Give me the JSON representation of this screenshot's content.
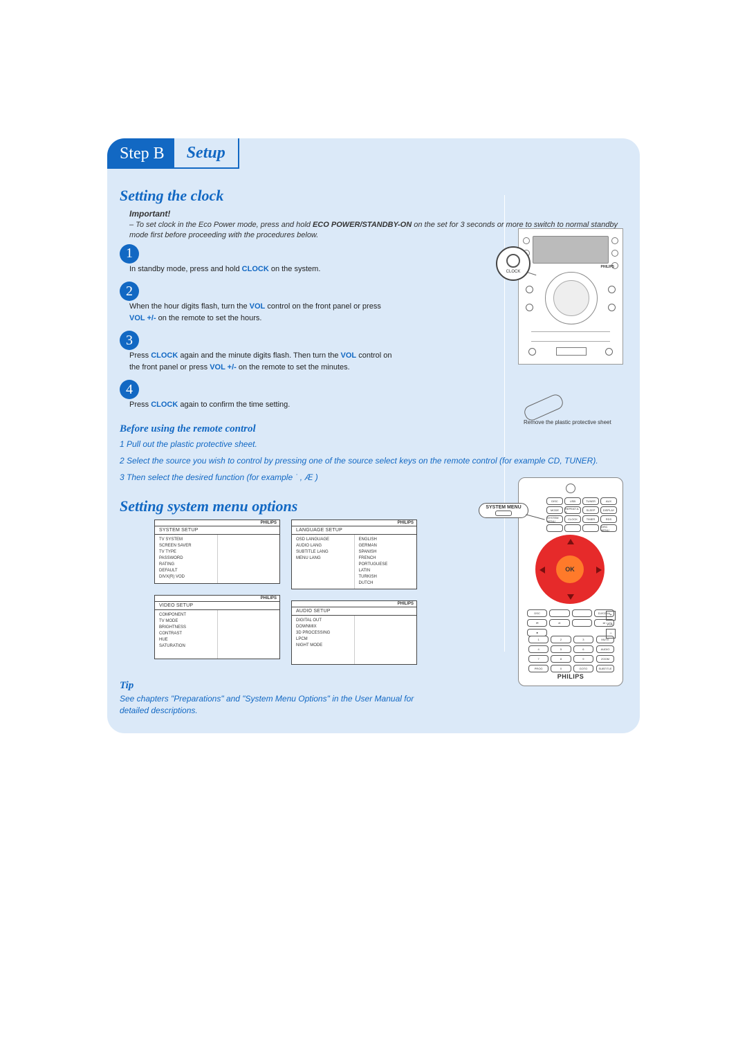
{
  "step_label": "Step B",
  "step_title": "Setup",
  "section1": {
    "heading": "Setting the clock",
    "important_label": "Important!",
    "important_text_pre": "– To set clock in the Eco Power mode, press and hold ",
    "important_bold": "ECO POWER/STANDBY-ON",
    "important_text_post": " on the set for 3 seconds or more to switch to normal standby mode first before proceeding with the procedures below.",
    "steps": [
      {
        "num": "1",
        "pre": "In standby mode, press and hold ",
        "kw1": "CLOCK",
        "post": " on the system."
      },
      {
        "num": "2",
        "pre": "When the hour digits flash, turn the ",
        "kw1": "VOL",
        "mid": " control on the front panel or press ",
        "kw2": "VOL +/-",
        "post": " on the remote to set the hours."
      },
      {
        "num": "3",
        "pre": "Press ",
        "kw1": "CLOCK",
        "mid": " again and the minute digits flash. Then turn the ",
        "kw2": "VOL",
        "mid2": " control on the front panel or press ",
        "kw3": "VOL +/-",
        "post": " on the remote to set the minutes."
      },
      {
        "num": "4",
        "pre": "Press ",
        "kw1": "CLOCK",
        "post": " again to confirm the time setting."
      }
    ]
  },
  "remote_section": {
    "heading": "Before using the remote control",
    "line1": "1 Pull out the plastic protective sheet.",
    "line2": "2 Select the source you wish to control by pressing one of the source select keys on the remote control (for example CD, TUNER).",
    "line3": "3 Then select the desired function (for example  ˙        , Æ    )",
    "caption": "Remove the plastic protective sheet"
  },
  "section2": {
    "heading": "Setting system menu options",
    "menus": [
      {
        "brand": "PHILIPS",
        "title": "SYSTEM SETUP",
        "items": [
          "TV SYSTEM",
          "SCREEN SAVER",
          "TV TYPE",
          "PASSWORD",
          "RATING",
          "DEFAULT",
          "DIVX(R) VOD"
        ],
        "values": []
      },
      {
        "brand": "PHILIPS",
        "title": "LANGUAGE SETUP",
        "items": [
          "OSD LANGUAGE",
          "AUDIO LANG",
          "SUBTITLE LANG",
          "MENU LANG"
        ],
        "values": [
          "ENGLISH",
          "GERMAN",
          "SPANISH",
          "FRENCH",
          "PORTUGUESE",
          "LATIN",
          "TURKISH",
          "DUTCH"
        ]
      },
      {
        "brand": "PHILIPS",
        "title": "VIDEO SETUP",
        "items": [
          "COMPONENT",
          "TV MODE",
          "BRIGHTNESS",
          "CONTRAST",
          "HUE",
          "SATURATION"
        ],
        "values": []
      },
      {
        "brand": "PHILIPS",
        "title": "AUDIO SETUP",
        "items": [
          "DIGITAL OUT",
          "DOWNMIX",
          "3D PROCESSING",
          "LPCM",
          "NIGHT MODE"
        ],
        "values": []
      }
    ]
  },
  "remote": {
    "sysmenu": "SYSTEM MENU",
    "top_row1": [
      "DISC",
      "USB",
      "TUNER",
      "AUX"
    ],
    "top_row2": [
      "MODE",
      "REPEAT A-B",
      "SLEEP",
      "DISPLAY"
    ],
    "top_row3": [
      "SYSTEM MENU",
      "CLOCK",
      "TIMER",
      "RDS"
    ],
    "top_row4": [
      "",
      "",
      "",
      "DISC MENU"
    ],
    "ok": "OK",
    "below": [
      "DSC",
      "",
      "",
      "DJ/CDDA"
    ],
    "transport": [
      "⏮",
      "⏯",
      "",
      "⏭",
      "⏹"
    ],
    "vol": [
      "+",
      "VOL",
      "−"
    ],
    "nums": [
      "1",
      "2",
      "3",
      "4",
      "5",
      "6",
      "7",
      "8",
      "9",
      "PROG",
      "0",
      "GOTO"
    ],
    "numpad_side": [
      "MUTE",
      "AUDIO",
      "ZOOM",
      "SUBTITLE"
    ],
    "brand": "PHILIPS"
  },
  "clock_label": "CLOCK",
  "device_brand": "PHILIPS",
  "tip": {
    "heading": "Tip",
    "text": "See chapters \"Preparations\" and \"System Menu Options\" in the User Manual for detailed descriptions."
  }
}
